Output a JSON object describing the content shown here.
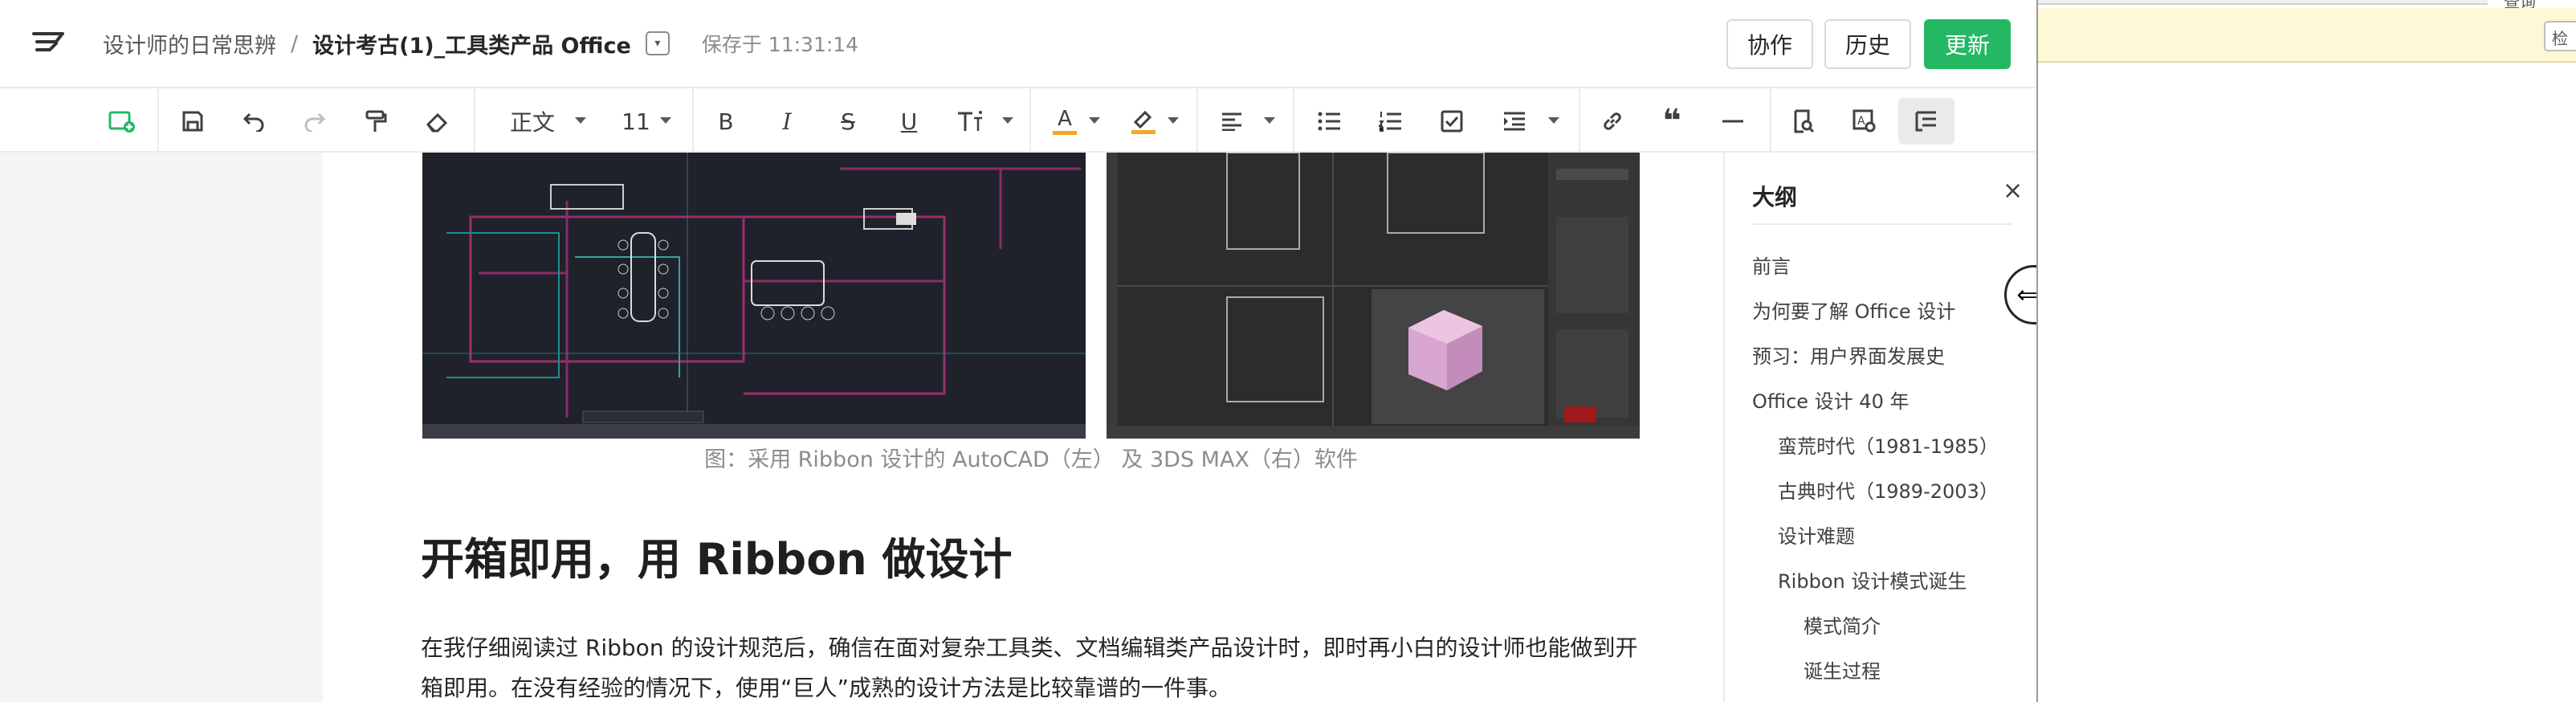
{
  "header": {
    "space_name": "设计师的日常思辨",
    "separator": "/",
    "doc_title": "设计考古(1)_工具类产品 Office",
    "save_status": "保存于 11:31:14",
    "collab_label": "协作",
    "history_label": "历史",
    "update_label": "更新",
    "brand_color": "#25b864"
  },
  "toolbar": {
    "paragraph_style": "正文",
    "font_size": "11",
    "icons": [
      "insert-doc-icon",
      "save-icon",
      "undo-icon",
      "redo-icon",
      "format-painter-icon",
      "eraser-icon",
      "bold-icon",
      "italic-icon",
      "strikethrough-icon",
      "underline-icon",
      "text-size-icon",
      "font-color-icon",
      "highlight-icon",
      "align-icon",
      "bullet-list-icon",
      "ordered-list-icon",
      "checklist-icon",
      "indent-icon",
      "link-icon",
      "quote-icon",
      "divider-icon",
      "find-icon",
      "find-replace-icon",
      "outline-icon"
    ],
    "font_color": "#f5a623",
    "highlight_color": "#f5a623",
    "bold": "B",
    "italic": "I",
    "strike": "S",
    "underline": "U",
    "font_color_glyph": "A",
    "quote_glyph": "❝"
  },
  "document": {
    "caption": "图：采用 Ribbon 设计的 AutoCAD（左） 及 3DS MAX（右）软件",
    "heading": "开箱即用，用 Ribbon 做设计",
    "paragraph": "在我仔细阅读过 Ribbon 的设计规范后，确信在面对复杂工具类、文档编辑类产品设计时，即时再小白的设计师也能做到开箱即用。在没有经验的情况下，使用“巨人”成熟的设计方法是比较靠谱的一件事。"
  },
  "outline": {
    "title": "大纲",
    "close_glyph": "×",
    "items": [
      {
        "label": "前言",
        "level": 1
      },
      {
        "label": "为何要了解 Office 设计",
        "level": 1
      },
      {
        "label": "预习：用户界面发展史",
        "level": 1
      },
      {
        "label": "Office 设计 40 年",
        "level": 1
      },
      {
        "label": "蛮荒时代（1981-1985）",
        "level": 2
      },
      {
        "label": "古典时代（1989-2003）",
        "level": 2
      },
      {
        "label": "设计难题",
        "level": 2
      },
      {
        "label": "Ribbon 设计模式诞生",
        "level": 2
      },
      {
        "label": "模式简介",
        "level": 3
      },
      {
        "label": "诞生过程",
        "level": 3
      }
    ]
  },
  "right_window": {
    "top_button": "查询",
    "side_button": "检"
  }
}
